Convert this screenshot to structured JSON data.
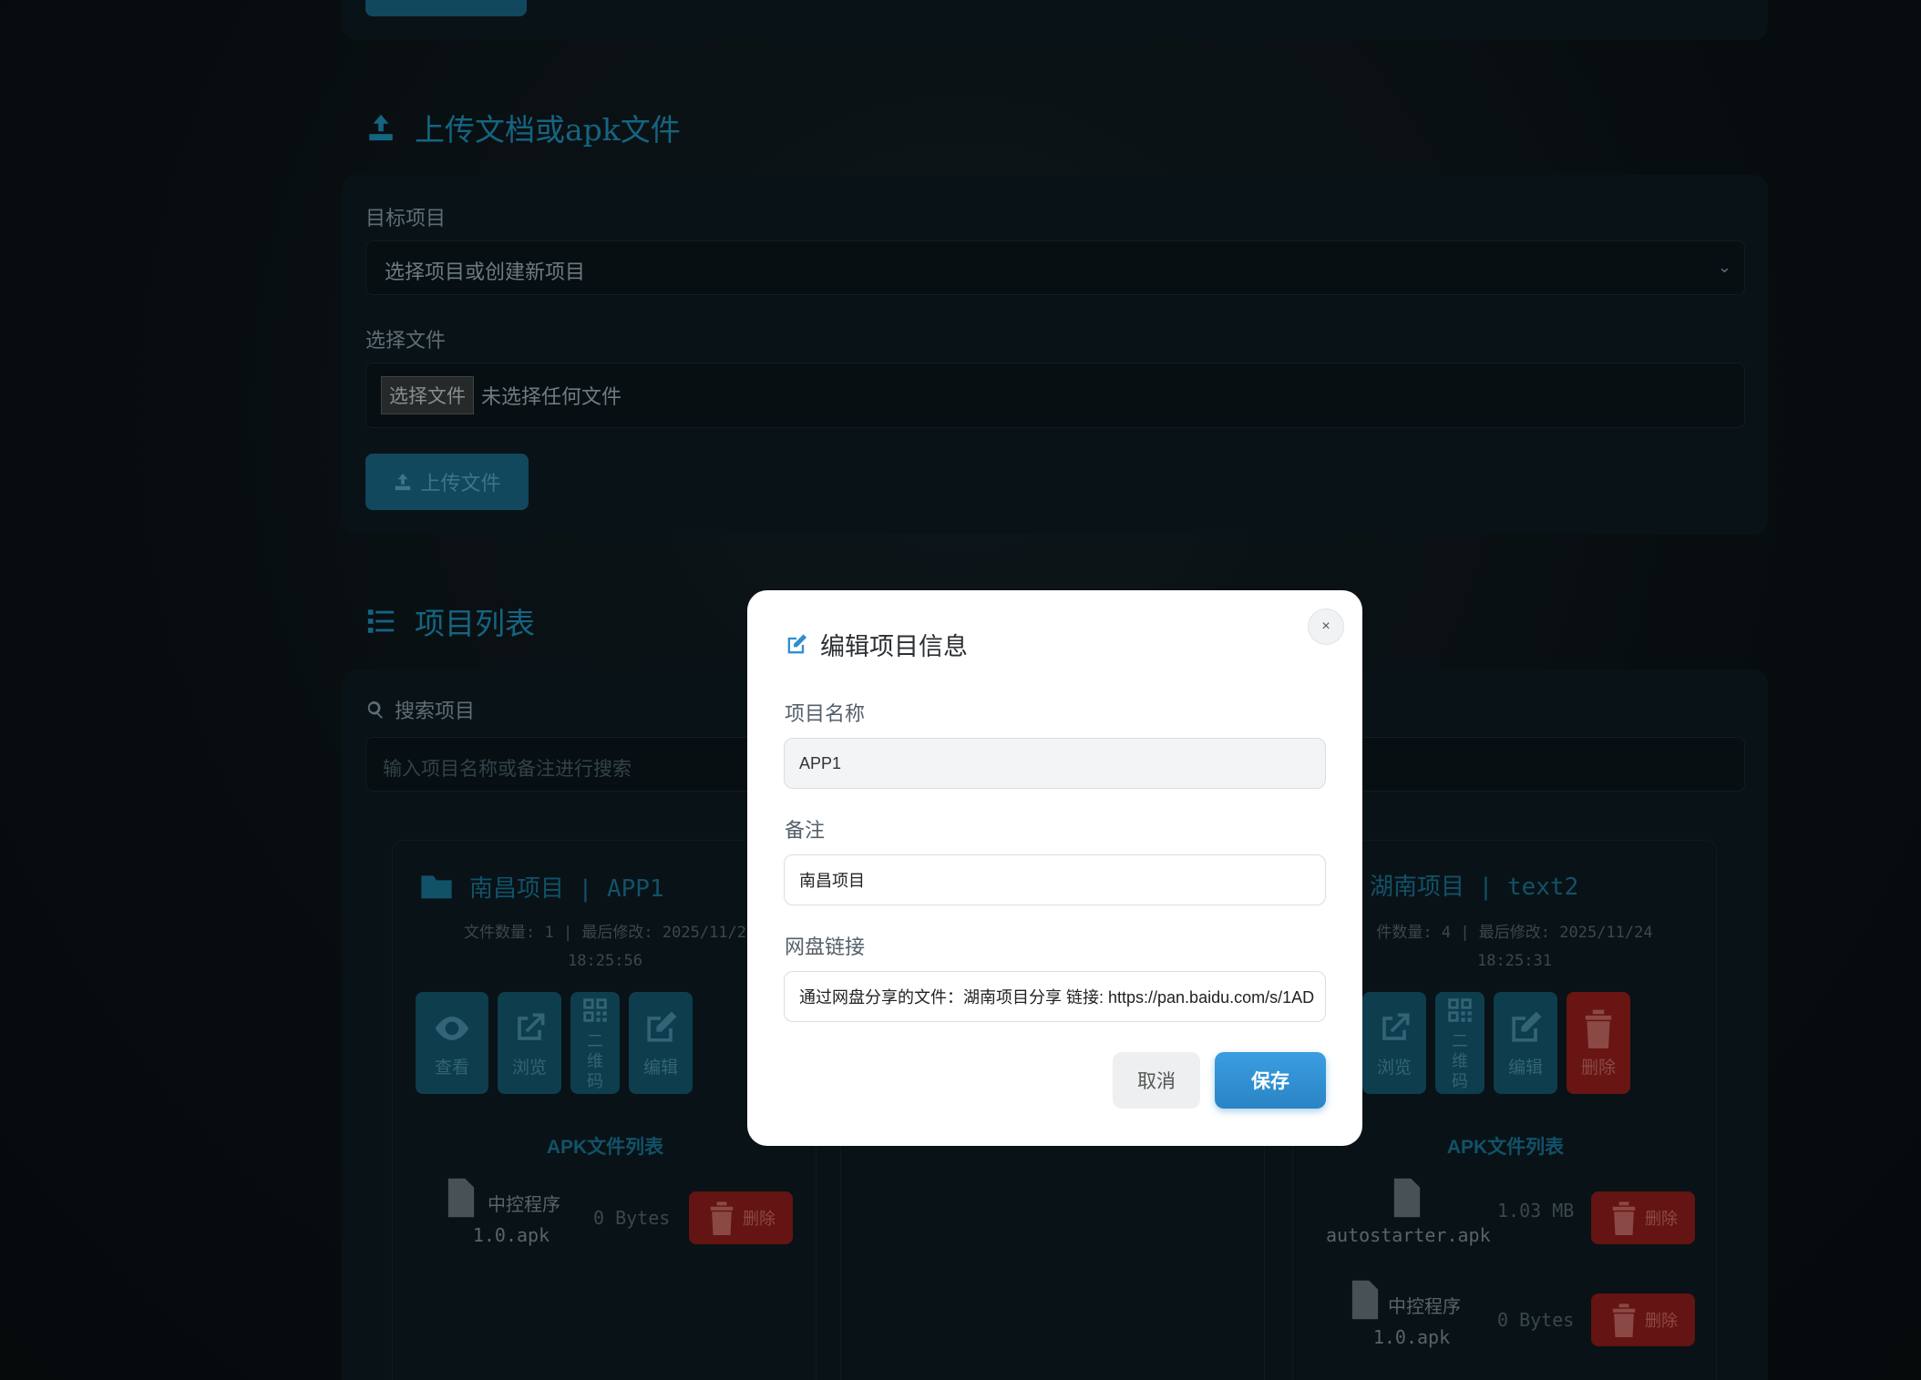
{
  "upload_section": {
    "title": "上传文档或apk文件",
    "target_label": "目标项目",
    "target_value": "选择项目或创建新项目",
    "file_label": "选择文件",
    "file_button": "选择文件",
    "file_status": "未选择任何文件",
    "upload_button": "上传文件"
  },
  "list_section": {
    "title": "项目列表",
    "search_label": "搜索项目",
    "search_placeholder": "输入项目名称或备注进行搜索"
  },
  "cards": [
    {
      "title": "南昌项目 | APP1",
      "meta_line1": "文件数量: 1 | 最后修改: 2025/11/2",
      "meta_line2": "18:25:56",
      "actions": [
        "查看",
        "浏览",
        "二维码",
        "编辑"
      ],
      "apk_title": "APK文件列表",
      "apks": [
        {
          "name": "中控程序",
          "name2": "1.0.apk",
          "size": "0 Bytes",
          "delete": "删除"
        }
      ]
    },
    {
      "title": "湖南项目 | text2",
      "meta_line1": "件数量: 4 | 最后修改: 2025/11/24",
      "meta_line2": "18:25:31",
      "actions": [
        "浏览",
        "二维码",
        "编辑",
        "删除"
      ],
      "apk_title": "APK文件列表",
      "apks": [
        {
          "name": "autostarter.apk",
          "size": "1.03 MB",
          "delete": "删除"
        },
        {
          "name": "中控程序",
          "name2": "1.0.apk",
          "size": "0 Bytes",
          "delete": "删除"
        }
      ]
    }
  ],
  "modal": {
    "title": "编辑项目信息",
    "close": "×",
    "name_label": "项目名称",
    "name_value": "APP1",
    "note_label": "备注",
    "note_value": "南昌项目",
    "link_label": "网盘链接",
    "link_value": "通过网盘分享的文件：湖南项目分享 链接: https://pan.baidu.com/s/1AD",
    "cancel": "取消",
    "save": "保存"
  },
  "colors": {
    "accent": "#1f9cc6",
    "primary_button": "#2a84c5",
    "danger": "#a0211e"
  }
}
